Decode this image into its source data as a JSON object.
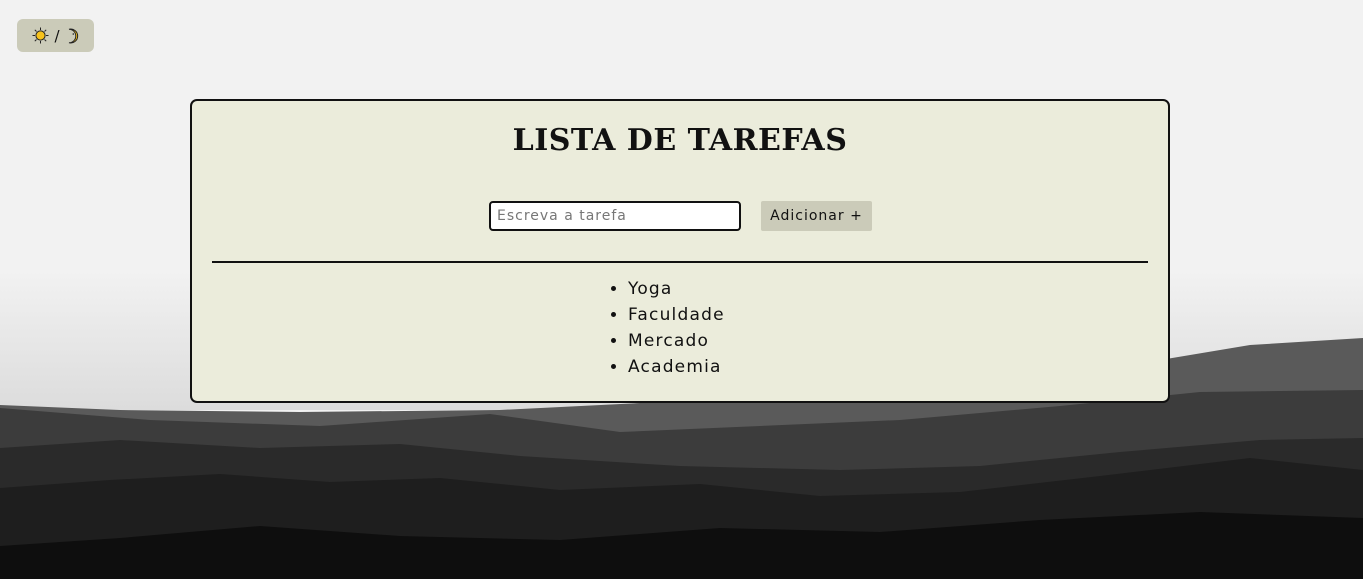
{
  "theme_toggle": {
    "sun_icon": "sun-icon",
    "separator": "/",
    "moon_icon": "moon-icon"
  },
  "todo": {
    "title": "LISTA DE TAREFAS",
    "input_placeholder": "Escreva a tarefa",
    "input_value": "",
    "add_button_label": "Adicionar +",
    "tasks": [
      "Yoga",
      "Faculdade",
      "Mercado",
      "Academia"
    ]
  },
  "colors": {
    "page_background": "#f2f2f2",
    "card_background": "#ebecdb",
    "button_background": "#cbcbb9",
    "border": "#111111"
  }
}
